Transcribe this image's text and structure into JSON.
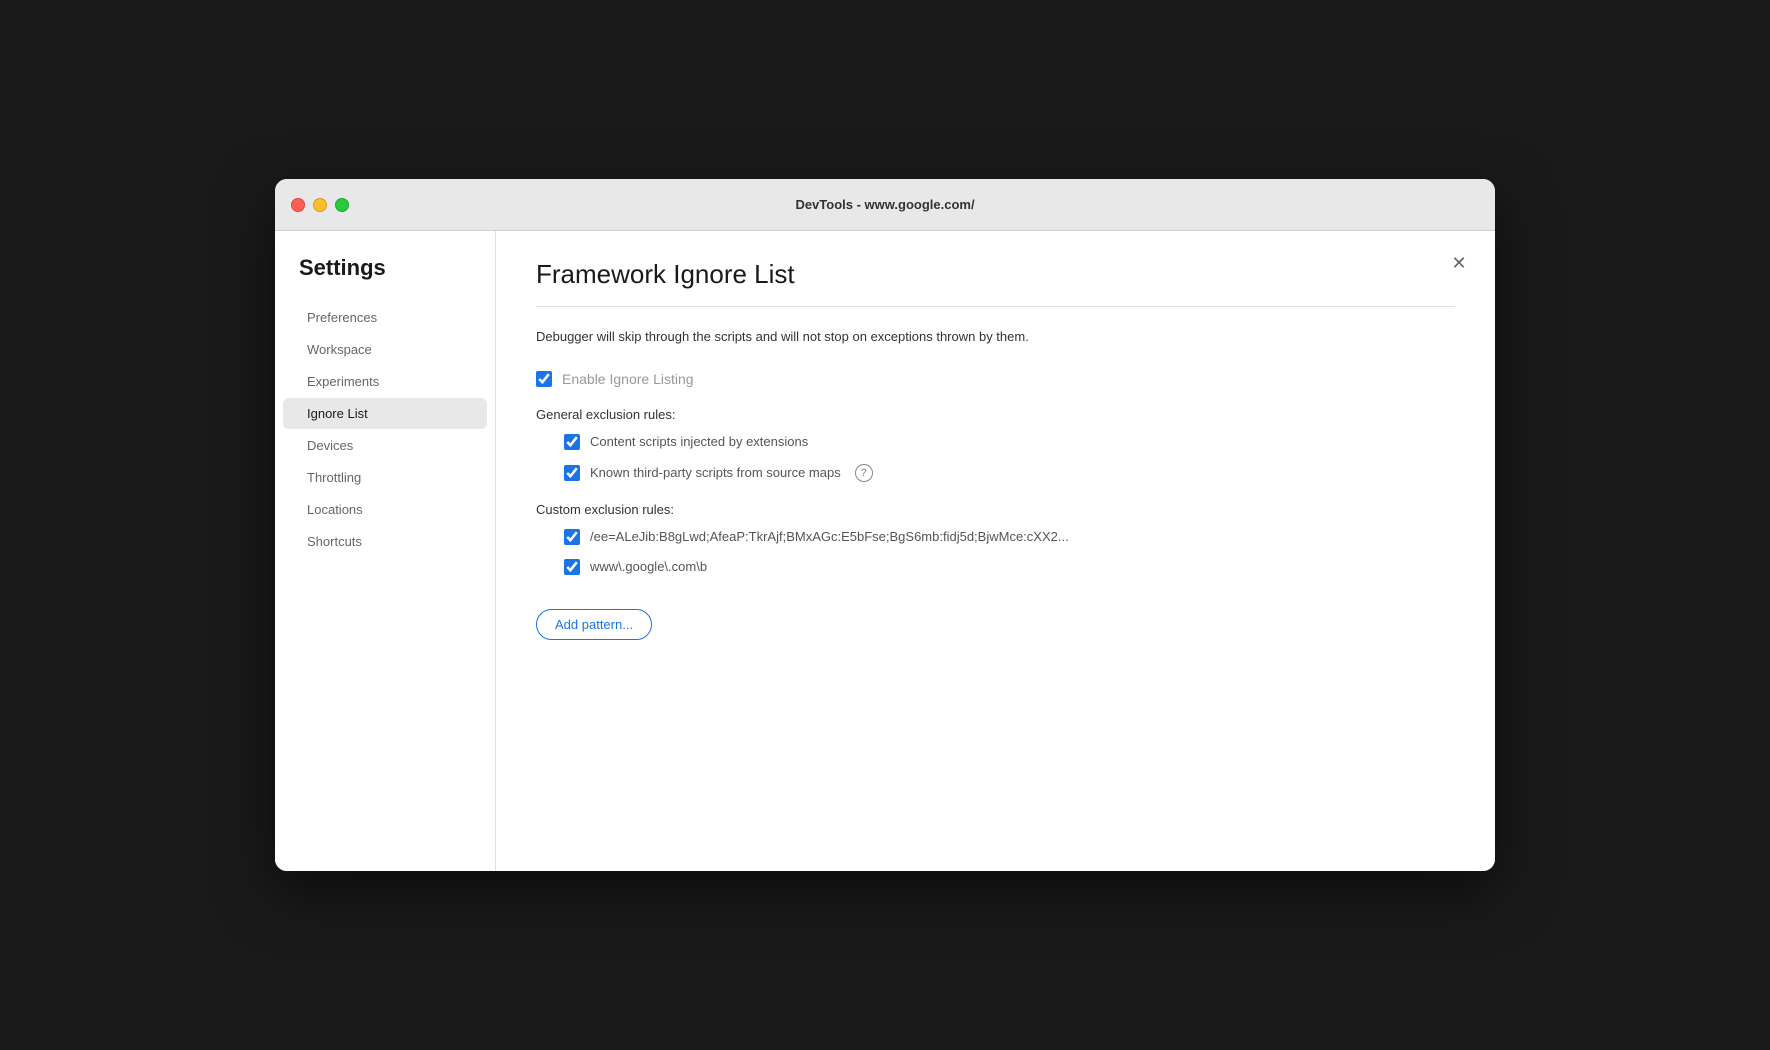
{
  "titlebar": {
    "title": "DevTools - www.google.com/"
  },
  "sidebar": {
    "heading": "Settings",
    "items": [
      {
        "id": "preferences",
        "label": "Preferences",
        "active": false
      },
      {
        "id": "workspace",
        "label": "Workspace",
        "active": false
      },
      {
        "id": "experiments",
        "label": "Experiments",
        "active": false
      },
      {
        "id": "ignore-list",
        "label": "Ignore List",
        "active": true
      },
      {
        "id": "devices",
        "label": "Devices",
        "active": false
      },
      {
        "id": "throttling",
        "label": "Throttling",
        "active": false
      },
      {
        "id": "locations",
        "label": "Locations",
        "active": false
      },
      {
        "id": "shortcuts",
        "label": "Shortcuts",
        "active": false
      }
    ]
  },
  "main": {
    "title": "Framework Ignore List",
    "description": "Debugger will skip through the scripts and will not stop on exceptions thrown by them.",
    "enable_ignore_listing_label": "Enable Ignore Listing",
    "enable_ignore_listing_checked": true,
    "general_section_label": "General exclusion rules:",
    "general_rules": [
      {
        "id": "content-scripts",
        "label": "Content scripts injected by extensions",
        "checked": true,
        "has_help": false
      },
      {
        "id": "third-party-scripts",
        "label": "Known third-party scripts from source maps",
        "checked": true,
        "has_help": true
      }
    ],
    "custom_section_label": "Custom exclusion rules:",
    "custom_rules": [
      {
        "id": "rule-1",
        "label": "/ee=ALeJib:B8gLwd;AfeaP:TkrAjf;BMxAGc:E5bFse;BgS6mb:fidj5d;BjwMce:cXX2...",
        "checked": true
      },
      {
        "id": "rule-2",
        "label": "www\\.google\\.com\\b",
        "checked": true
      }
    ],
    "add_pattern_label": "Add pattern..."
  }
}
